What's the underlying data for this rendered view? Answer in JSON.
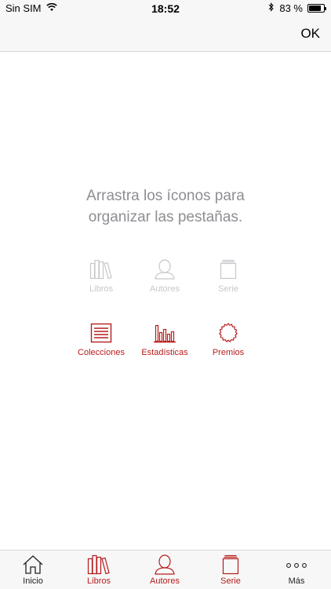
{
  "status_bar": {
    "carrier": "Sin SIM",
    "time": "18:52",
    "battery_text": "83 %",
    "battery_level": 0.83
  },
  "nav": {
    "ok_label": "OK"
  },
  "instruction": {
    "line1": "Arrastra los íconos para",
    "line2": "organizar las pestañas."
  },
  "placed_icons": [
    {
      "label": "Libros",
      "icon": "books-icon"
    },
    {
      "label": "Autores",
      "icon": "person-icon"
    },
    {
      "label": "Serie",
      "icon": "series-icon"
    }
  ],
  "available_icons": [
    {
      "label": "Colecciones",
      "icon": "list-icon"
    },
    {
      "label": "Estadísticas",
      "icon": "bar-chart-icon"
    },
    {
      "label": "Premios",
      "icon": "award-seal-icon"
    }
  ],
  "tabs": [
    {
      "label": "Inicio",
      "icon": "home-icon"
    },
    {
      "label": "Libros",
      "icon": "books-icon"
    },
    {
      "label": "Autores",
      "icon": "person-icon"
    },
    {
      "label": "Serie",
      "icon": "series-icon"
    },
    {
      "label": "Más",
      "icon": "more-icon"
    }
  ],
  "colors": {
    "accent": "#b71c1c",
    "disabled": "#c7c7cc",
    "instruction": "#8e8e93"
  }
}
